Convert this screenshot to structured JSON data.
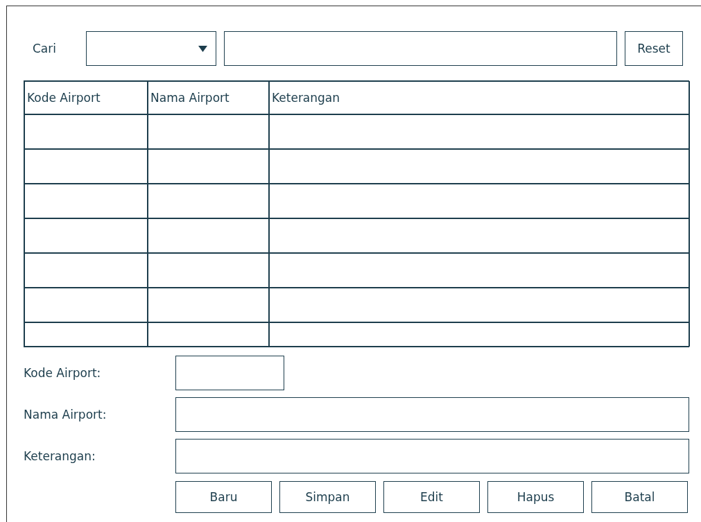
{
  "search": {
    "label": "Cari",
    "reset_button": "Reset"
  },
  "table": {
    "columns": [
      "Kode Airport",
      "Nama Airport",
      "Keterangan"
    ]
  },
  "form": {
    "fields": [
      {
        "label": "Kode Airport:",
        "kind": "short"
      },
      {
        "label": "Nama Airport:",
        "kind": "wide"
      },
      {
        "label": "Keterangan:",
        "kind": "wide"
      }
    ]
  },
  "buttons": [
    "Baru",
    "Simpan",
    "Edit",
    "Hapus",
    "Batal"
  ]
}
